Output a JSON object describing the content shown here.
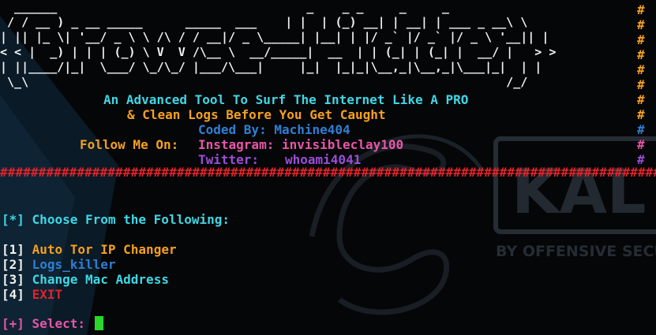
{
  "colors": {
    "background": "#050608",
    "ascii_art": "#f2f2f2",
    "cyan": "#3fd7e4",
    "orange": "#f5a020",
    "blue": "#2f7fd3",
    "pink": "#e856a8",
    "purple": "#9a4ed6",
    "red": "#e0242a",
    "green_cursor": "#2bd62b",
    "watermark": "#2a3038"
  },
  "banner": {
    "ascii_art": "  ______                                   _    _ _     _     _\n / / __ ) _ __ _____      _____  ___    | |  | (_) __| | __| | ___ _ __\\ \\\n| || |_ \\| '__/ _ \\ \\ /\\ / / __|/ _ \\_____| |__| | |/ _` |/ _` |/ _ \\ '__|| |\n< < |  _) | | | (_) \\ V  V /\\__ \\  __/_____|  __  | | (_| | (_| |  __/ |   > >\n| ||____/|_|  \\___/ \\_/\\_/ |___/\\___|     |_|  |_|_|\\__,_|\\__,_|\\___|_|  | |\n \\_\\                                                                   /_/",
    "tagline_line1": "An Advanced Tool To Surf The Internet Like A PRO",
    "tagline_line2": "& Clean Logs Before You Get Caught",
    "coded_by": "Coded By: Machine404",
    "follow_label": "Follow Me On:",
    "instagram": "Instagram: invisibleclay100",
    "twitter_label": "Twitter:",
    "twitter_handle": "whoami4041"
  },
  "right_border": [
    "#",
    "#",
    "#",
    "#",
    "#",
    "#",
    "#",
    "#",
    "#",
    "#",
    "#"
  ],
  "divider": "########################################################################################",
  "menu": {
    "prompt_bracket": "[*]",
    "prompt_text": "Choose From the Following:",
    "items": [
      {
        "num": "1",
        "label": "Auto Tor IP Changer"
      },
      {
        "num": "2",
        "label": "Logs_killer"
      },
      {
        "num": "3",
        "label": "Change Mac Address"
      },
      {
        "num": "4",
        "label": "EXIT"
      }
    ],
    "select_bracket": "[+]",
    "select_label": "Select:"
  },
  "watermark": {
    "brand": "KAL",
    "subline": "BY OFFENSIVE SECU"
  }
}
